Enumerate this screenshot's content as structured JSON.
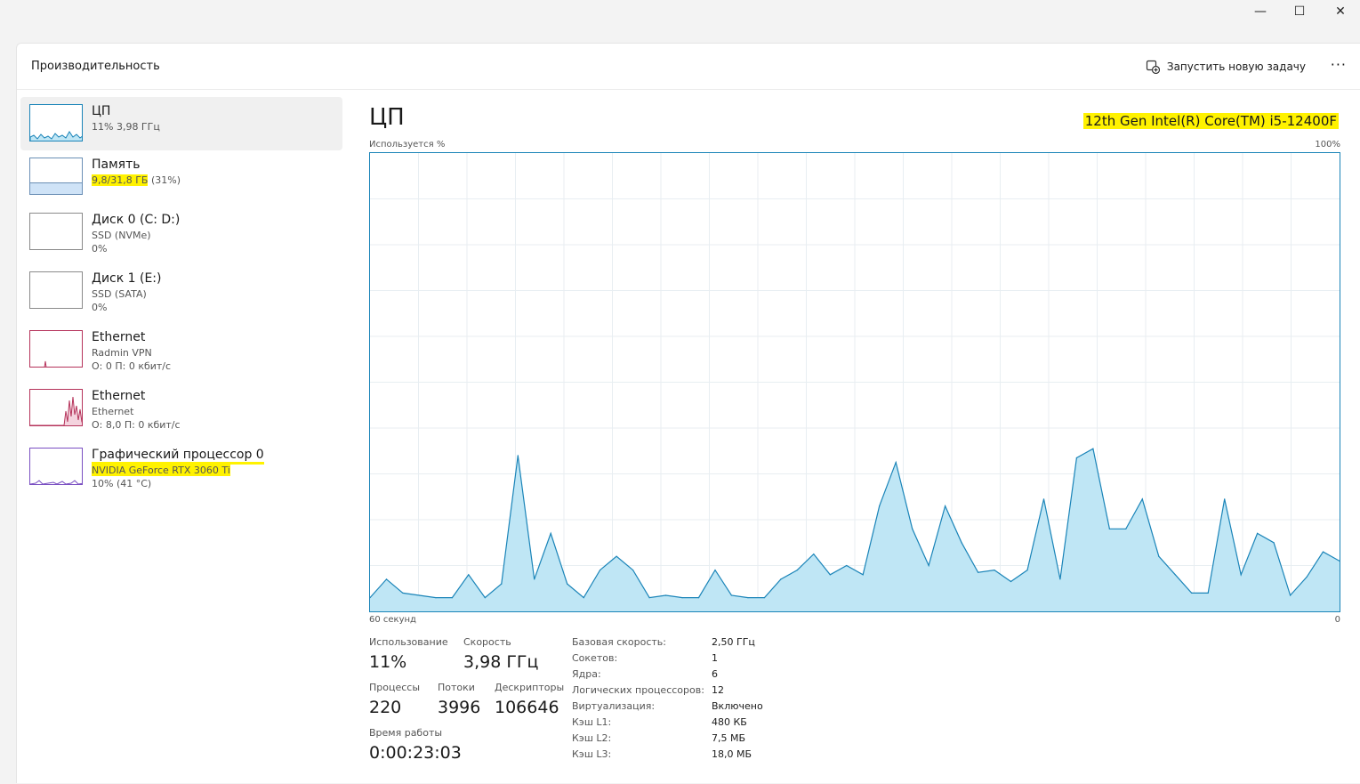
{
  "window": {
    "minimize": "—",
    "maximize": "☐",
    "close": "✕"
  },
  "header": {
    "title": "Производительность",
    "run_task_label": "Запустить новую задачу",
    "more": "···"
  },
  "sidebar": {
    "items": [
      {
        "name": "ЦП",
        "sub1": "11% 3,98 ГГц",
        "sub2": ""
      },
      {
        "name": "Память",
        "sub1": "9,8/31,8 ГБ",
        "sub1b": "(31%)",
        "sub2": ""
      },
      {
        "name": "Диск 0 (C: D:)",
        "sub1": "SSD (NVMe)",
        "sub2": "0%"
      },
      {
        "name": "Диск 1 (E:)",
        "sub1": "SSD (SATA)",
        "sub2": "0%"
      },
      {
        "name": "Ethernet",
        "sub1": "Radmin VPN",
        "sub2": "О: 0 П: 0 кбит/с"
      },
      {
        "name": "Ethernet",
        "sub1": "Ethernet",
        "sub2": "О: 8,0 П: 0 кбит/с"
      },
      {
        "name": "Графический процессор 0",
        "sub1": "NVIDIA GeForce RTX 3060 Ti",
        "sub2": "10% (41 °C)"
      }
    ]
  },
  "main": {
    "title": "ЦП",
    "model": "12th Gen Intel(R) Core(TM) i5-12400F",
    "graph_ylabel": "Используется %",
    "graph_ymax": "100%",
    "graph_xlabel_left": "60 секунд",
    "graph_xlabel_right": "0"
  },
  "stats": {
    "usage_label": "Использование",
    "usage_value": "11%",
    "speed_label": "Скорость",
    "speed_value": "3,98 ГГц",
    "processes_label": "Процессы",
    "processes_value": "220",
    "threads_label": "Потоки",
    "threads_value": "3996",
    "handles_label": "Дескрипторы",
    "handles_value": "106646",
    "uptime_label": "Время работы",
    "uptime_value": "0:00:23:03"
  },
  "specs": [
    {
      "k": "Базовая скорость:",
      "v": "2,50 ГГц"
    },
    {
      "k": "Сокетов:",
      "v": "1"
    },
    {
      "k": "Ядра:",
      "v": "6"
    },
    {
      "k": "Логических процессоров:",
      "v": "12"
    },
    {
      "k": "Виртуализация:",
      "v": "Включено"
    },
    {
      "k": "Кэш L1:",
      "v": "480 КБ"
    },
    {
      "k": "Кэш L2:",
      "v": "7,5 МБ"
    },
    {
      "k": "Кэш L3:",
      "v": "18,0 МБ"
    }
  ],
  "colors": {
    "cpu_line": "#1a84b8",
    "cpu_fill": "#bfe6f5",
    "mem_fill": "#cfe3f7",
    "net_line": "#b5325a",
    "gpu_line": "#7a4fc2",
    "highlight": "#fff200"
  },
  "chart_data": {
    "type": "area",
    "y_units": "percent",
    "ylim": [
      0,
      100
    ],
    "x_range_seconds": [
      60,
      0
    ],
    "values": [
      3,
      7,
      4,
      3.5,
      3,
      3,
      8,
      3,
      6,
      34,
      7,
      17,
      6,
      3,
      9,
      12,
      9,
      3,
      3.5,
      3,
      3,
      9,
      3.5,
      3,
      3,
      7,
      9,
      12.5,
      8,
      10,
      8,
      23,
      32.5,
      18,
      10,
      23,
      15,
      8.5,
      9,
      6.5,
      9,
      24.5,
      7,
      33.5,
      35.5,
      18,
      18,
      24.5,
      12,
      8,
      4,
      4,
      24.5,
      8,
      17,
      15,
      3.5,
      7.5,
      13,
      11
    ]
  }
}
